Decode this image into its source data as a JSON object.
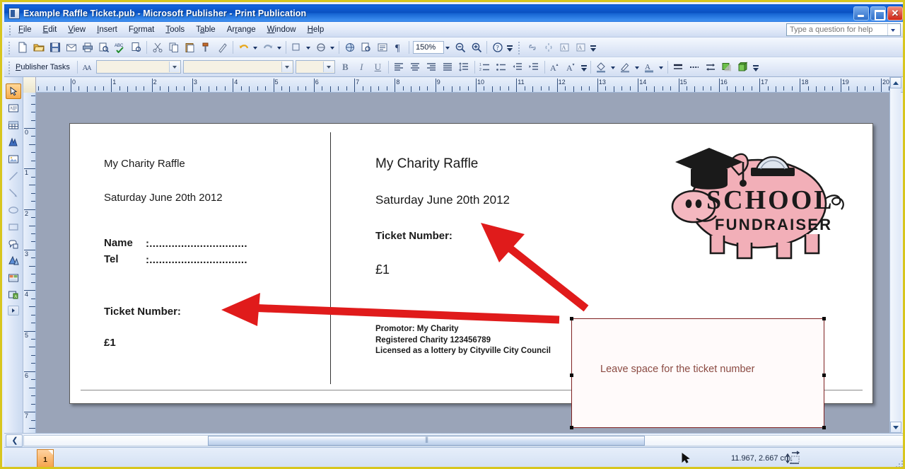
{
  "window": {
    "title": "Example Raffle Ticket.pub - Microsoft Publisher - Print Publication",
    "app_icon": "publisher-document-icon",
    "minimize_label": "Minimize",
    "maximize_label": "Restore",
    "close_label": "Close"
  },
  "menu": {
    "items": [
      {
        "label": "File"
      },
      {
        "label": "Edit"
      },
      {
        "label": "View"
      },
      {
        "label": "Insert"
      },
      {
        "label": "Format"
      },
      {
        "label": "Tools"
      },
      {
        "label": "Table"
      },
      {
        "label": "Arrange"
      },
      {
        "label": "Window"
      },
      {
        "label": "Help"
      }
    ],
    "help_box": {
      "placeholder": "Type a question for help",
      "value": ""
    }
  },
  "standard_toolbar": {
    "buttons": [
      {
        "icon": "new-document-icon",
        "label": "New"
      },
      {
        "icon": "open-folder-icon",
        "label": "Open"
      },
      {
        "icon": "save-disk-icon",
        "label": "Save"
      },
      {
        "icon": "email-icon",
        "label": "E-mail"
      },
      {
        "icon": "print-icon",
        "label": "Print"
      },
      {
        "icon": "print-preview-icon",
        "label": "Print Preview"
      },
      {
        "icon": "spelling-abc-icon",
        "label": "Spelling"
      },
      {
        "icon": "design-checker-icon",
        "label": "Design Checker"
      },
      {
        "icon": "cut-scissors-icon",
        "label": "Cut"
      },
      {
        "icon": "copy-icon",
        "label": "Copy"
      },
      {
        "icon": "paste-clipboard-icon",
        "label": "Paste"
      },
      {
        "icon": "format-painter-icon",
        "label": "Format Painter"
      },
      {
        "icon": "brush-icon",
        "label": "Brush"
      },
      {
        "icon": "undo-arrow-icon",
        "label": "Undo"
      },
      {
        "icon": "redo-arrow-icon",
        "label": "Redo"
      },
      {
        "icon": "insert-object-icon",
        "label": "Insert Object"
      },
      {
        "icon": "hyperlink-icon",
        "label": "Hyperlink"
      },
      {
        "icon": "web-page-preview-icon",
        "label": "Web Page Preview"
      },
      {
        "icon": "find-icon",
        "label": "Find"
      },
      {
        "icon": "special-characters-icon",
        "label": "Special Characters"
      },
      {
        "icon": "paragraph-mark-icon",
        "label": "Show Formatting Marks"
      }
    ],
    "zoom_value": "150%",
    "zoom_out_icon": "zoom-out-icon",
    "zoom_in_icon": "zoom-in-icon",
    "help_icon": "help-question-icon",
    "overflow_icon": "toolbar-options-icon"
  },
  "formatting_toolbar": {
    "publisher_tasks_label": "Publisher Tasks",
    "styles_icon": "styles-and-formatting-icon",
    "style_value": "",
    "font_value": "",
    "size_value": "",
    "bold_label": "B",
    "italic_label": "I",
    "underline_label": "U",
    "buttons": [
      {
        "icon": "align-left-icon",
        "label": "Align Left"
      },
      {
        "icon": "align-center-icon",
        "label": "Center"
      },
      {
        "icon": "align-right-icon",
        "label": "Align Right"
      },
      {
        "icon": "justify-icon",
        "label": "Justify"
      },
      {
        "icon": "line-spacing-icon",
        "label": "Line Spacing"
      },
      {
        "icon": "numbered-list-icon",
        "label": "Numbering"
      },
      {
        "icon": "bulleted-list-icon",
        "label": "Bullets"
      },
      {
        "icon": "decrease-indent-icon",
        "label": "Decrease Indent"
      },
      {
        "icon": "increase-indent-icon",
        "label": "Increase Indent"
      },
      {
        "icon": "grow-font-icon",
        "label": "Increase Font Size"
      },
      {
        "icon": "shrink-font-icon",
        "label": "Decrease Font Size"
      },
      {
        "icon": "fill-color-icon",
        "label": "Fill Color"
      },
      {
        "icon": "line-color-icon",
        "label": "Line Color"
      },
      {
        "icon": "font-color-icon",
        "label": "Font Color"
      },
      {
        "icon": "line-style-icon",
        "label": "Line/Border Style"
      },
      {
        "icon": "dash-style-icon",
        "label": "Dash Style"
      },
      {
        "icon": "arrow-style-icon",
        "label": "Arrow Style"
      },
      {
        "icon": "shadow-style-icon",
        "label": "Shadow Style"
      },
      {
        "icon": "3d-style-icon",
        "label": "3-D Style"
      }
    ],
    "connect_buttons": [
      {
        "icon": "link-textboxes-icon",
        "label": "Create Text Box Link"
      },
      {
        "icon": "break-link-icon",
        "label": "Break Forward Link"
      },
      {
        "icon": "previous-textbox-icon",
        "label": "Go to Previous Text Box"
      },
      {
        "icon": "next-textbox-icon",
        "label": "Go to Next Text Box"
      }
    ]
  },
  "objects_toolbar": {
    "items": [
      {
        "icon": "select-pointer-icon",
        "label": "Select Objects",
        "selected": true
      },
      {
        "icon": "text-box-icon",
        "label": "Text Box",
        "selected": false
      },
      {
        "icon": "insert-table-icon",
        "label": "Insert Table",
        "selected": false
      },
      {
        "icon": "wordart-icon",
        "label": "Insert WordArt",
        "selected": false
      },
      {
        "icon": "picture-frame-icon",
        "label": "Picture Frame",
        "selected": false
      },
      {
        "icon": "line-tool-icon",
        "label": "Line",
        "selected": false
      },
      {
        "icon": "arrow-tool-icon",
        "label": "Arrow",
        "selected": false
      },
      {
        "icon": "oval-tool-icon",
        "label": "Oval",
        "selected": false
      },
      {
        "icon": "rectangle-tool-icon",
        "label": "Rectangle",
        "selected": false
      },
      {
        "icon": "autoshapes-icon",
        "label": "AutoShapes",
        "selected": false
      },
      {
        "icon": "design-gallery-icon",
        "label": "Design Gallery Object",
        "selected": false
      },
      {
        "icon": "item-from-content-library-icon",
        "label": "Item from Content Library",
        "selected": false
      },
      {
        "icon": "insert-object-frame-icon",
        "label": "Insert Object",
        "selected": false
      }
    ],
    "more_label": "More Buttons"
  },
  "rulers": {
    "unit": "cm",
    "horizontal_ticks": [
      "0",
      "1",
      "2",
      "3",
      "4",
      "5",
      "6",
      "7",
      "8",
      "9",
      "10",
      "11",
      "12",
      "13",
      "14",
      "15",
      "16",
      "17",
      "18",
      "19",
      "20"
    ],
    "vertical_ticks": [
      "0",
      "1",
      "2",
      "3",
      "4",
      "5",
      "6",
      "7"
    ]
  },
  "document": {
    "stub": {
      "title": "My Charity Raffle",
      "date": "Saturday June 20th 2012",
      "name_label": "Name",
      "name_line": ":...............................",
      "tel_label": "Tel",
      "tel_line": ":...............................",
      "ticket_number_label": "Ticket Number:",
      "price": "£1"
    },
    "ticket": {
      "title": "My Charity Raffle",
      "date": "Saturday June 20th 2012",
      "ticket_number_label": "Ticket Number:",
      "price": "£1",
      "fine_print": [
        "Promotor: My Charity",
        "Registered Charity 123456789",
        "Licensed as a lottery by Cityville City Council"
      ]
    },
    "logo": {
      "name": "piggy-bank-school-fundraiser-logo",
      "line1": "SCHOOL",
      "line2": "FUNDRAISER",
      "body_color": "#f2afb8",
      "cap_color": "#1a1a1a"
    }
  },
  "annotations": {
    "arrow_color": "#e01b1b",
    "arrows": [
      {
        "name": "arrow-to-stub-ticket-number"
      },
      {
        "name": "arrow-to-ticket-ticket-number"
      }
    ],
    "callout": {
      "text": "Leave space for the ticket number",
      "border_color": "#7e2020",
      "text_color": "#8b4a42"
    }
  },
  "status_bar": {
    "page_number": "1",
    "coordinates": "11.967, 2.667 cm.",
    "cursor_icon": "mouse-pointer-icon",
    "object_size_icon": "object-size-icon"
  },
  "scrollbars": {
    "previous_page_label": "Previous Page",
    "scroll_up_label": "Scroll Up",
    "scroll_down_label": "Scroll Down"
  }
}
